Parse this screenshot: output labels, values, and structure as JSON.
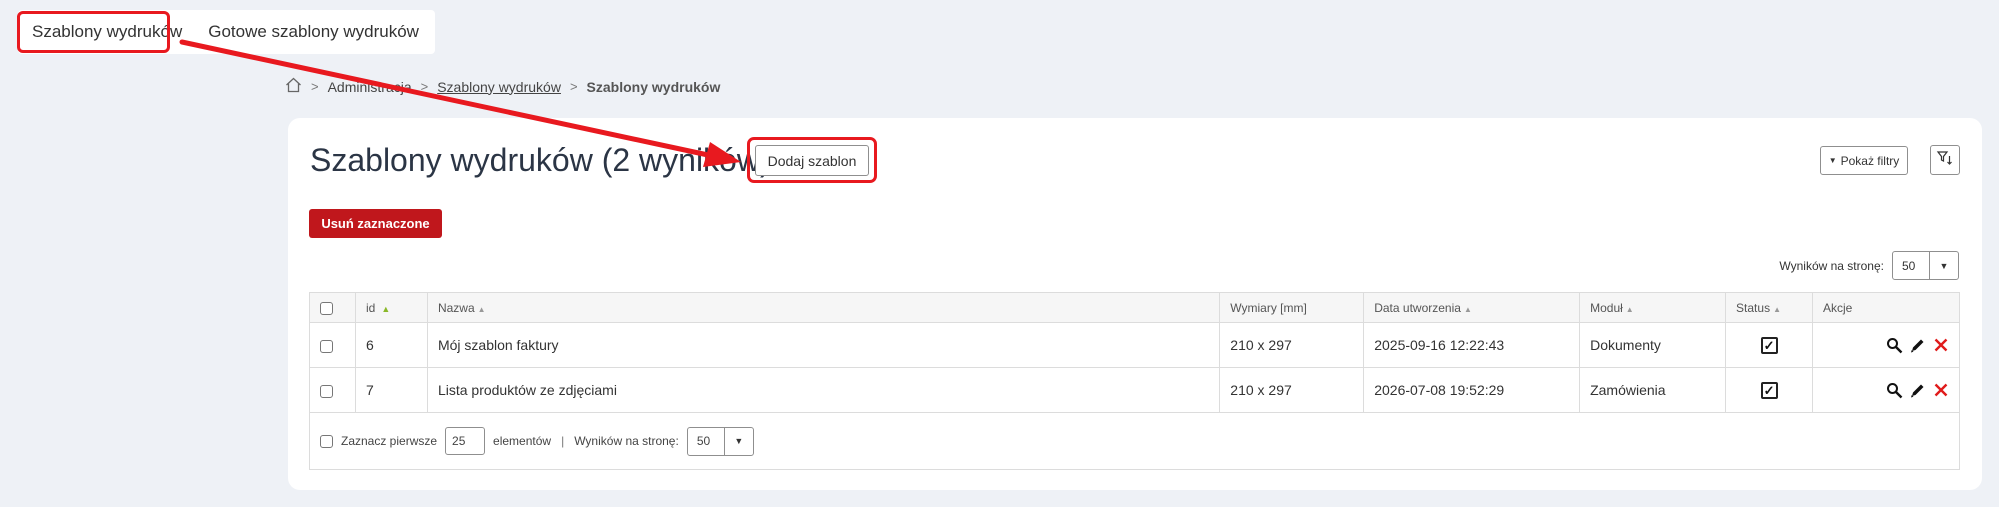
{
  "tabs": [
    {
      "label": "Szablony wydruków",
      "active": true
    },
    {
      "label": "Gotowe szablony wydruków",
      "active": false
    }
  ],
  "breadcrumb": {
    "home_icon": "home-icon",
    "items": [
      "Administracja",
      "Szablony wydruków",
      "Szablony wydruków"
    ]
  },
  "header": {
    "title": "Szablony wydruków (2 wyników)",
    "add_button": "Dodaj szablon",
    "show_filters": "Pokaż filtry"
  },
  "toolbar": {
    "delete_selected": "Usuń zaznaczone",
    "per_page_label": "Wyników na stronę:",
    "per_page_value": "50"
  },
  "table": {
    "columns": [
      "id",
      "Nazwa",
      "Wymiary [mm]",
      "Data utworzenia",
      "Moduł",
      "Status",
      "Akcje"
    ],
    "rows": [
      {
        "id": "6",
        "name": "Mój szablon faktury",
        "dimensions": "210 x 297",
        "created": "2025-09-16 12:22:43",
        "module": "Dokumenty",
        "status": true
      },
      {
        "id": "7",
        "name": "Lista produktów ze zdjęciami",
        "dimensions": "210 x 297",
        "created": "2026-07-08 19:52:29",
        "module": "Zamówienia",
        "status": true
      }
    ]
  },
  "footer": {
    "select_first": "Zaznacz pierwsze",
    "first_value": "25",
    "elements": "elementów",
    "per_page_label": "Wyników na stronę:",
    "per_page_value": "50"
  },
  "colors": {
    "accent_red": "#c0171c",
    "highlight_red": "#e8191f",
    "background": "#eef1f6"
  }
}
